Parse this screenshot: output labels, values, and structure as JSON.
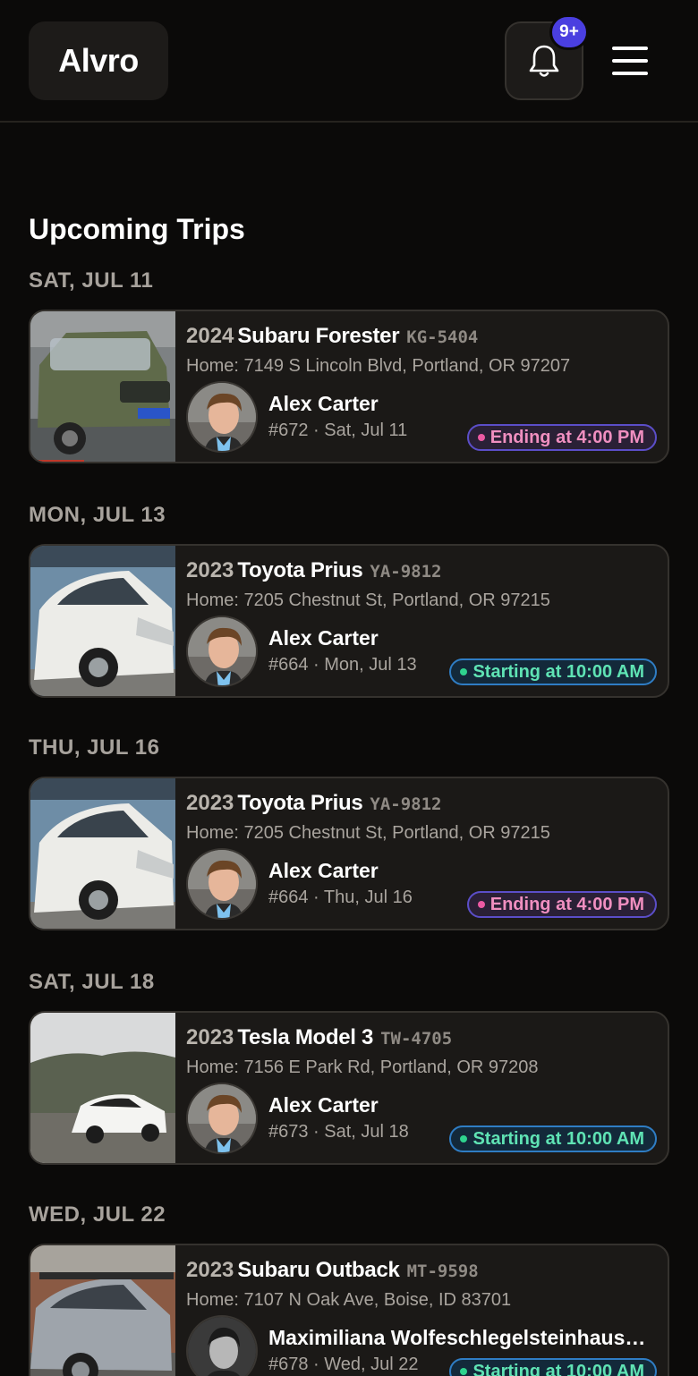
{
  "app": {
    "logo": "Alvro",
    "notification_badge": "9+"
  },
  "section_title": "Upcoming Trips",
  "days": [
    {
      "label": "SAT, JUL 11",
      "trip": {
        "year": "2024",
        "car": "Subaru Forester",
        "plate": "KG-5404",
        "address": "Home: 7149 S Lincoln Blvd, Portland, OR 97207",
        "host": "Alex Carter",
        "meta": "#672 · Sat, Jul 11",
        "status": "Ending at 4:00 PM",
        "status_type": "ending"
      }
    },
    {
      "label": "MON, JUL 13",
      "trip": {
        "year": "2023",
        "car": "Toyota Prius",
        "plate": "YA-9812",
        "address": "Home: 7205 Chestnut St, Portland, OR 97215",
        "host": "Alex Carter",
        "meta": "#664 · Mon, Jul 13",
        "status": "Starting at 10:00 AM",
        "status_type": "starting"
      }
    },
    {
      "label": "THU, JUL 16",
      "trip": {
        "year": "2023",
        "car": "Toyota Prius",
        "plate": "YA-9812",
        "address": "Home: 7205 Chestnut St, Portland, OR 97215",
        "host": "Alex Carter",
        "meta": "#664 · Thu, Jul 16",
        "status": "Ending at 4:00 PM",
        "status_type": "ending"
      }
    },
    {
      "label": "SAT, JUL 18",
      "trip": {
        "year": "2023",
        "car": "Tesla Model 3",
        "plate": "TW-4705",
        "address": "Home: 7156 E Park Rd, Portland, OR 97208",
        "host": "Alex Carter",
        "meta": "#673 · Sat, Jul 18",
        "status": "Starting at 10:00 AM",
        "status_type": "starting"
      }
    },
    {
      "label": "WED, JUL 22",
      "trip": {
        "year": "2023",
        "car": "Subaru Outback",
        "plate": "MT-9598",
        "address": "Home: 7107 N Oak Ave, Boise, ID 83701",
        "host": "Maximiliana Wolfeschlegelsteinhausenbergerdorff",
        "meta": "#678 · Wed, Jul 22",
        "status": "Starting at 10:00 AM",
        "status_type": "starting"
      }
    }
  ],
  "colors": {
    "background": "#0b0a09",
    "card": "#1b1917",
    "ending_accent": "#ec5aa3",
    "starting_accent": "#2fd38e",
    "badge": "#4a3fe0"
  }
}
